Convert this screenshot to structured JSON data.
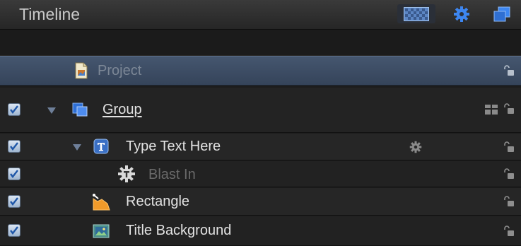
{
  "header": {
    "title": "Timeline",
    "buttons": [
      {
        "icon": "checker-pattern-icon",
        "active": true
      },
      {
        "icon": "gear-icon"
      },
      {
        "icon": "layers-window-icon"
      }
    ]
  },
  "layers": [
    {
      "name": "Project",
      "icon": "project-document-icon",
      "selected": true,
      "checkbox": false,
      "locked": false
    },
    {
      "name": "Group",
      "icon": "group-icon",
      "checked": true,
      "expanded": true,
      "locked": false
    },
    {
      "name": "Type Text Here",
      "icon": "text-layer-icon",
      "checked": true,
      "expanded": true,
      "behavior_badge": "gear-icon",
      "locked": false
    },
    {
      "name": "Blast In",
      "icon": "behavior-icon",
      "checked": true,
      "locked": false
    },
    {
      "name": "Rectangle",
      "icon": "shape-icon",
      "checked": true,
      "locked": false
    },
    {
      "name": "Title Background",
      "icon": "image-layer-icon",
      "checked": true,
      "locked": false
    }
  ],
  "colors": {
    "accent": "#3c7be0",
    "selection": "#3f506a"
  }
}
